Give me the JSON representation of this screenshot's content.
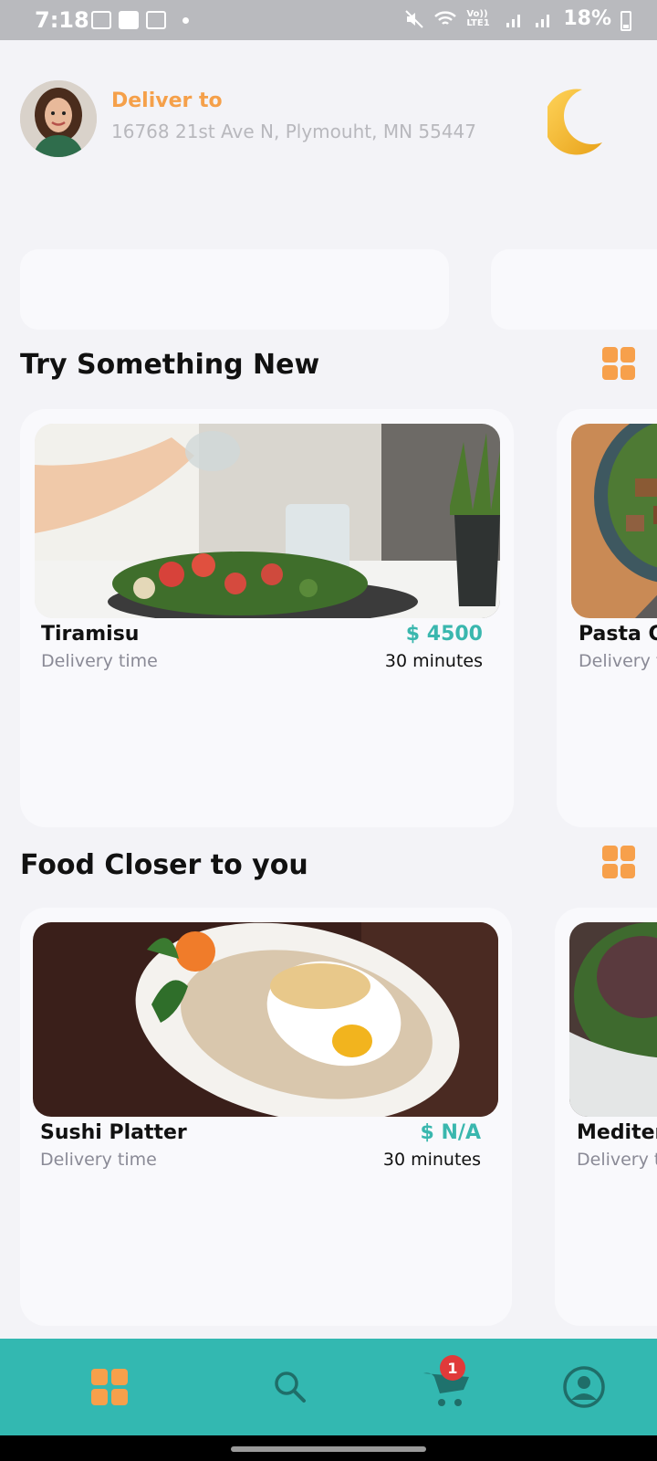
{
  "status_bar": {
    "time": "7:18",
    "battery": "18%",
    "network_label": "Vo)) LTE1"
  },
  "header": {
    "deliver_label": "Deliver to",
    "address": "16768 21st Ave N, Plymouht, MN 55447",
    "theme_icon": "moon-icon"
  },
  "sections": [
    {
      "title": "Try Something New",
      "cards": [
        {
          "name": "Tiramisu",
          "delivery_label": "Delivery time",
          "price": "$ 4500",
          "time": "30 minutes"
        },
        {
          "name": "Pasta C",
          "delivery_label": "Delivery t"
        }
      ]
    },
    {
      "title": "Food Closer to you",
      "cards": [
        {
          "name": "Sushi Platter",
          "delivery_label": "Delivery time",
          "price": "$ N/A",
          "time": "30 minutes"
        },
        {
          "name": "Mediter",
          "delivery_label": "Delivery t"
        }
      ]
    }
  ],
  "bottom_nav": {
    "items": [
      "home-grid-icon",
      "search-icon",
      "cart-icon",
      "profile-icon"
    ],
    "cart_badge": "1"
  },
  "colors": {
    "accent_orange": "#f7a04b",
    "teal": "#33b8b1",
    "price_teal": "#3ab7ae",
    "badge_red": "#e03a3a"
  }
}
